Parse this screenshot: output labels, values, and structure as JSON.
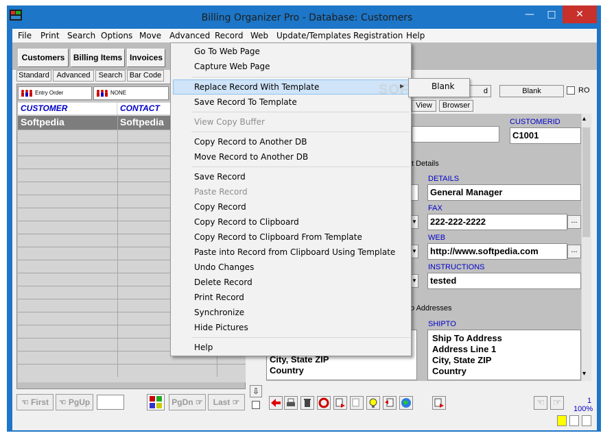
{
  "window": {
    "title": "Billing Organizer Pro - Database: Customers",
    "close_icon": "close-icon",
    "minimize_icon": "minimize-icon"
  },
  "menubar": [
    "File",
    "Print",
    "Search",
    "Options",
    "Move",
    "Advanced",
    "Record",
    "Web",
    "Update/Templates",
    "Registration",
    "Help"
  ],
  "main_tabs": [
    "Customers",
    "Billing Items",
    "Invoices"
  ],
  "sub_tabs": [
    "Standard",
    "Advanced",
    "Search",
    "Bar Code"
  ],
  "sort": {
    "order_label": "Entry Order",
    "filter_label": "NONE"
  },
  "grid": {
    "headers": [
      "CUSTOMER",
      "CONTACT"
    ],
    "rows": [
      [
        "Softpedia",
        "Softpedia"
      ]
    ]
  },
  "nav": {
    "first": "First",
    "pgup": "PgUp",
    "pgdn": "PgDn",
    "last": "Last"
  },
  "record": {
    "template_btn_suffix": "d",
    "blank_btn": "Blank",
    "ro_label": "RO",
    "view_tabs": [
      "View",
      "Browser"
    ],
    "customerid_label": "CUSTOMERID",
    "customerid_value": "C1001",
    "section_details": "t Details",
    "details_label": "DETAILS",
    "details_value": "General Manager",
    "fax_label": "FAX",
    "fax_value": "222-222-2222",
    "web_label": "WEB",
    "web_value": "http://www.softpedia.com",
    "instructions_label": "INSTRUCTIONS",
    "instructions_value": "tested",
    "section_addresses": "o Addresses",
    "shipto_label": "SHIPTO",
    "shipto_lines": [
      "Ship To Address",
      "Address Line 1",
      "City,  State  ZIP",
      "Country"
    ],
    "billto_lines_visible": [
      "City,  State  ZIP",
      "Country"
    ],
    "ellipsis": "...",
    "page": "1",
    "zoom": "100%"
  },
  "dropdown": {
    "items": [
      {
        "label": "Go To Web Page",
        "enabled": true
      },
      {
        "label": "Capture Web Page",
        "enabled": true
      },
      {
        "label": "Replace Record With Template",
        "enabled": true,
        "submenu": true
      },
      {
        "label": "Save Record To Template",
        "enabled": true
      },
      {
        "label": "View Copy Buffer",
        "enabled": false
      },
      {
        "label": "Copy Record to Another DB",
        "enabled": true
      },
      {
        "label": "Move Record to Another DB",
        "enabled": true
      },
      {
        "label": "Save Record",
        "enabled": true
      },
      {
        "label": "Paste Record",
        "enabled": false
      },
      {
        "label": "Copy Record",
        "enabled": true
      },
      {
        "label": "Copy Record to Clipboard",
        "enabled": true
      },
      {
        "label": "Copy Record to Clipboard From Template",
        "enabled": true
      },
      {
        "label": "Paste into Record from Clipboard Using Template",
        "enabled": true
      },
      {
        "label": "Undo Changes",
        "enabled": true
      },
      {
        "label": "Delete Record",
        "enabled": true
      },
      {
        "label": "Print Record",
        "enabled": true
      },
      {
        "label": "Synchronize",
        "enabled": true
      },
      {
        "label": "Hide Pictures",
        "enabled": true
      },
      {
        "label": "Help",
        "enabled": true
      }
    ],
    "submenu_arrow": "▶",
    "submenu_items": [
      "Blank"
    ]
  },
  "watermark": "SOFTPEDI"
}
